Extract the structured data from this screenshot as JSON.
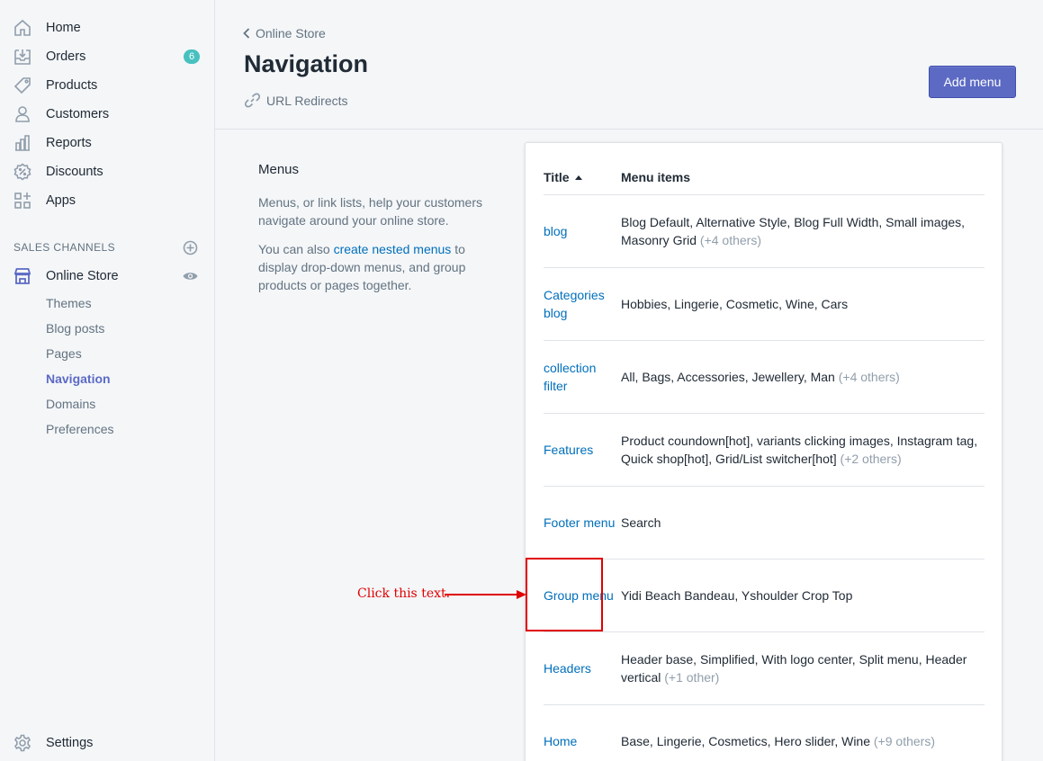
{
  "sidebar": {
    "items": [
      {
        "label": "Home",
        "icon": "home-icon"
      },
      {
        "label": "Orders",
        "icon": "orders-icon",
        "badge": "6"
      },
      {
        "label": "Products",
        "icon": "tag-icon"
      },
      {
        "label": "Customers",
        "icon": "user-icon"
      },
      {
        "label": "Reports",
        "icon": "bar-chart-icon"
      },
      {
        "label": "Discounts",
        "icon": "discount-icon"
      },
      {
        "label": "Apps",
        "icon": "apps-icon"
      }
    ],
    "sales_channels_title": "SALES CHANNELS",
    "online_store": {
      "label": "Online Store"
    },
    "sub_items": [
      "Themes",
      "Blog posts",
      "Pages",
      "Navigation",
      "Domains",
      "Preferences"
    ],
    "active_sub": "Navigation",
    "settings": {
      "label": "Settings"
    }
  },
  "header": {
    "breadcrumb": "Online Store",
    "title": "Navigation",
    "redirects_link": "URL Redirects",
    "add_menu_label": "Add menu"
  },
  "intro": {
    "title": "Menus",
    "para1": "Menus, or link lists, help your customers navigate around your online store.",
    "para2_prefix": "You can also ",
    "para2_link": "create nested menus",
    "para2_suffix": " to display drop-down menus, and group products or pages together."
  },
  "table": {
    "col_title": "Title",
    "col_items": "Menu items",
    "rows": [
      {
        "title": "blog",
        "items": "Blog Default, Alternative Style, Blog Full Width, Small images, Masonry Grid",
        "more": "(+4 others)"
      },
      {
        "title": "Categories blog",
        "items": "Hobbies, Lingerie, Cosmetic, Wine, Cars",
        "more": ""
      },
      {
        "title": "collection filter",
        "items": "All, Bags, Accessories, Jewellery, Man",
        "more": "(+4 others)"
      },
      {
        "title": "Features",
        "items": "Product coundown[hot], variants clicking images, Instagram tag, Quick shop[hot], Grid/List switcher[hot]",
        "more": "(+2 others)"
      },
      {
        "title": "Footer menu",
        "items": "Search",
        "more": ""
      },
      {
        "title": "Group menu",
        "items": "Yidi Beach Bandeau, Yshoulder Crop Top",
        "more": ""
      },
      {
        "title": "Headers",
        "items": "Header base, Simplified, With logo center, Split menu, Header vertical",
        "more": "(+1 other)"
      },
      {
        "title": "Home",
        "items": "Base, Lingerie, Cosmetics, Hero slider, Wine",
        "more": "(+9 others)"
      }
    ]
  },
  "annotation": {
    "text": "Click this text.",
    "color": "#e00000"
  },
  "colors": {
    "accent": "#5c6ac4",
    "link": "#006fbb",
    "badge": "#47c1bf"
  }
}
